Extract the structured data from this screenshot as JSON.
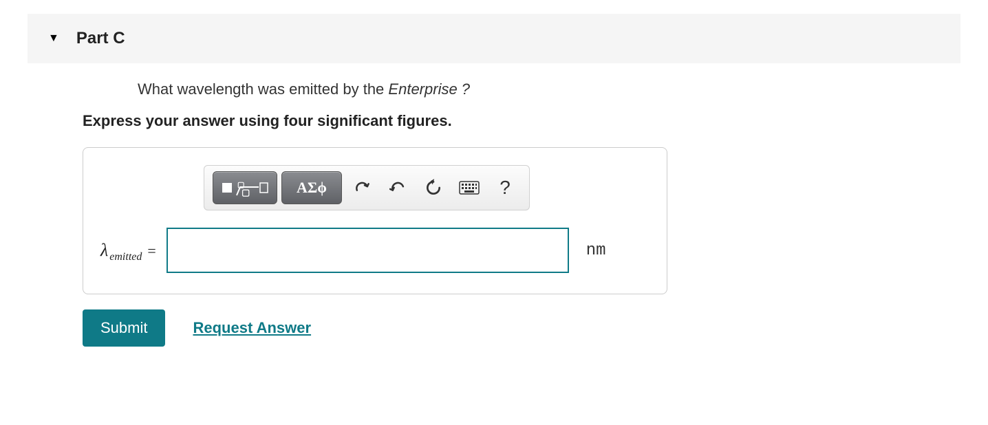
{
  "part": {
    "title": "Part C"
  },
  "question": {
    "prefix": "What wavelength was emitted by the ",
    "italic": "Enterprise ?",
    "instruction": "Express your answer using four significant figures."
  },
  "toolbar": {
    "greek_label": "ΑΣϕ",
    "help_label": "?"
  },
  "answer": {
    "symbol": "λ",
    "subscript": "emitted",
    "equals": "=",
    "value": "",
    "unit": "nm"
  },
  "actions": {
    "submit": "Submit",
    "request": "Request Answer"
  }
}
